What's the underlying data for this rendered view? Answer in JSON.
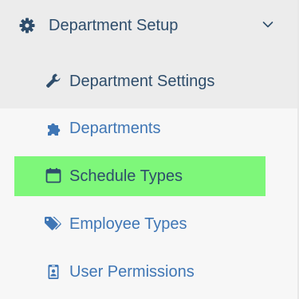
{
  "section": {
    "title": "Department Setup",
    "icon": "gear-icon",
    "expanded": true
  },
  "items": [
    {
      "label": "Department Settings",
      "icon": "wrench-icon"
    },
    {
      "label": "Departments",
      "icon": "puzzle-icon"
    },
    {
      "label": "Schedule Types",
      "icon": "calendar-icon",
      "active": true
    },
    {
      "label": "Employee Types",
      "icon": "tags-icon"
    },
    {
      "label": "User Permissions",
      "icon": "id-badge-icon"
    }
  ],
  "colors": {
    "header_text": "#2e4d6b",
    "link_text": "#3f76b5",
    "active_bg": "#7ef77a",
    "header_bg": "#ececec",
    "panel_bg": "#f7f7f7"
  }
}
